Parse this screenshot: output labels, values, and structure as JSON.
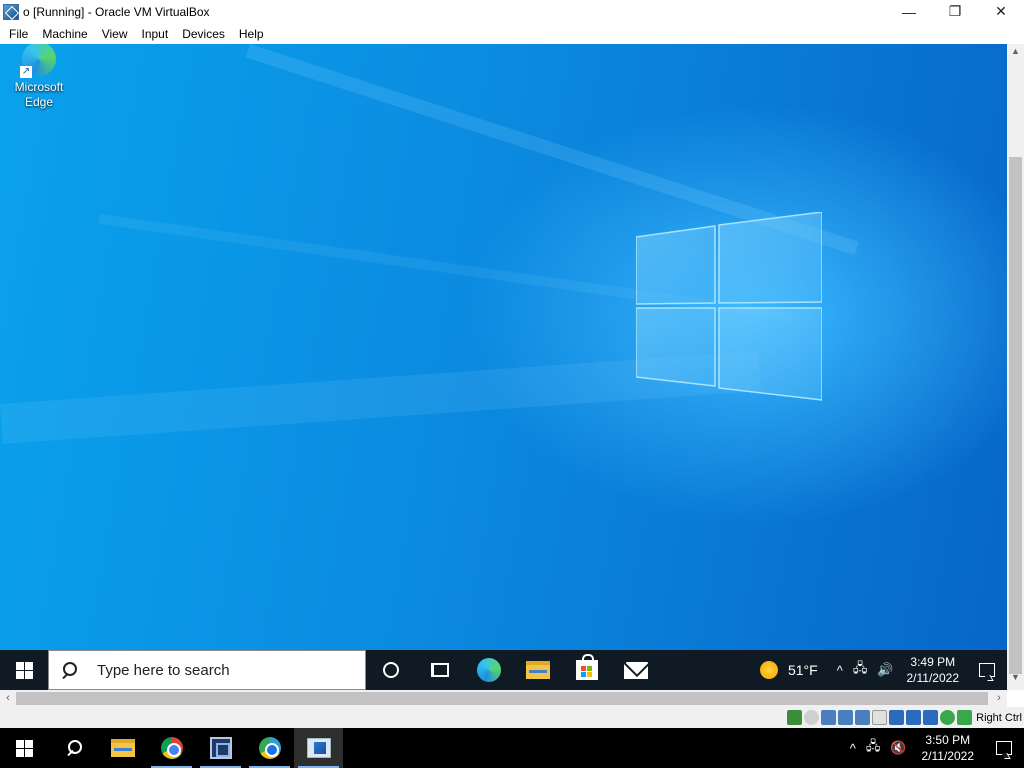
{
  "window": {
    "title": "o [Running] - Oracle VM VirtualBox",
    "controls": {
      "minimize": "—",
      "restore": "❐",
      "close": "✕"
    }
  },
  "menu": [
    "File",
    "Machine",
    "View",
    "Input",
    "Devices",
    "Help"
  ],
  "guest": {
    "desktop_icons": [
      {
        "label": "Microsoft Edge",
        "icon": "edge-icon"
      }
    ],
    "taskbar": {
      "search_placeholder": "Type here to search",
      "pinned": [
        "cortana-icon",
        "task-view-icon",
        "edge-icon",
        "file-explorer-icon",
        "store-icon",
        "mail-icon"
      ],
      "weather": {
        "temp": "51°F",
        "icon": "sun-icon"
      },
      "clock": {
        "time": "3:49 PM",
        "date": "2/11/2022"
      },
      "tray_glyphs": {
        "chevron": "^",
        "network": "🖧",
        "volume": "🔊"
      }
    }
  },
  "statusbar": {
    "host_key": "Right Ctrl",
    "icons": [
      {
        "name": "hard-disk-icon",
        "color": "#3b8d3b"
      },
      {
        "name": "optical-drive-icon",
        "color": "#cfcfcf"
      },
      {
        "name": "audio-icon",
        "color": "#4a7fbf"
      },
      {
        "name": "network-icon",
        "color": "#4a7fbf"
      },
      {
        "name": "usb-icon",
        "color": "#4a7fbf"
      },
      {
        "name": "shared-folders-icon",
        "color": "#e0e0e0"
      },
      {
        "name": "display-icon",
        "color": "#2a6bbf"
      },
      {
        "name": "video-capture-icon",
        "color": "#2a6bbf"
      },
      {
        "name": "virtualization-icon",
        "color": "#2a6bbf"
      },
      {
        "name": "mouse-integration-icon",
        "color": "#3aa84a"
      },
      {
        "name": "keyboard-icon",
        "color": "#3aa84a"
      }
    ]
  },
  "host_taskbar": {
    "apps": [
      "search-icon",
      "file-explorer-icon",
      "chrome-icon",
      "virtualbox-icon",
      "chrome-canary-icon",
      "vm-window-icon"
    ],
    "clock": {
      "time": "3:50 PM",
      "date": "2/11/2022"
    },
    "tray_glyphs": {
      "chevron": "^",
      "network": "🖧",
      "volume": "🔇"
    }
  },
  "colors": {
    "guest_taskbar": "#101a24",
    "host_taskbar": "#000000",
    "desktop_blue": "#0b8be0",
    "logo_light": "#7fd3ff"
  }
}
